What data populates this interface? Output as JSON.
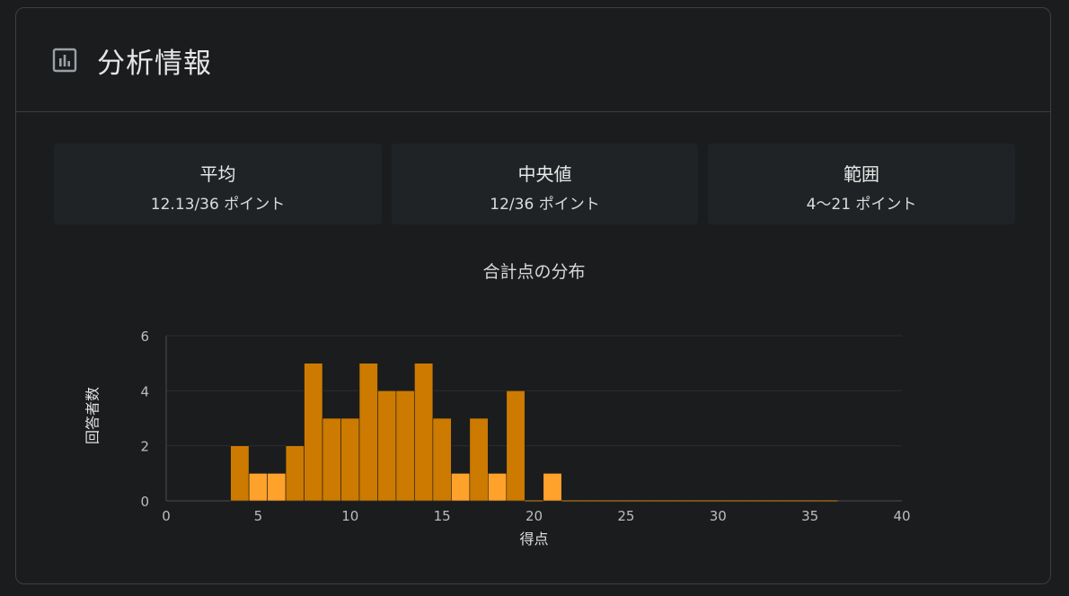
{
  "card": {
    "title": "分析情報",
    "icon": "bar-chart-icon"
  },
  "stats": [
    {
      "label": "平均",
      "value": "12.13/36 ポイント"
    },
    {
      "label": "中央値",
      "value": "12/36 ポイント"
    },
    {
      "label": "範囲",
      "value": "4〜21 ポイント"
    }
  ],
  "colors": {
    "primary_bar": "#cc7a00",
    "highlight_bar": "#ffa22b",
    "background": "#1b1c1e",
    "grid": "#2a2c2f"
  },
  "chart_data": {
    "type": "bar",
    "title": "合計点の分布",
    "xlabel": "得点",
    "ylabel": "回答者数",
    "xlim": [
      0,
      40
    ],
    "ylim": [
      0,
      6
    ],
    "xticks": [
      0,
      5,
      10,
      15,
      20,
      25,
      30,
      35,
      40
    ],
    "yticks": [
      0,
      2,
      4,
      6
    ],
    "bin_width": 1,
    "bins": [
      {
        "x": 4,
        "count": 2,
        "highlight": false
      },
      {
        "x": 5,
        "count": 1,
        "highlight": true
      },
      {
        "x": 6,
        "count": 1,
        "highlight": true
      },
      {
        "x": 7,
        "count": 2,
        "highlight": false
      },
      {
        "x": 8,
        "count": 5,
        "highlight": false
      },
      {
        "x": 9,
        "count": 3,
        "highlight": false
      },
      {
        "x": 10,
        "count": 3,
        "highlight": false
      },
      {
        "x": 11,
        "count": 5,
        "highlight": false
      },
      {
        "x": 12,
        "count": 4,
        "highlight": false
      },
      {
        "x": 13,
        "count": 4,
        "highlight": false
      },
      {
        "x": 14,
        "count": 5,
        "highlight": false
      },
      {
        "x": 15,
        "count": 3,
        "highlight": false
      },
      {
        "x": 16,
        "count": 1,
        "highlight": true
      },
      {
        "x": 17,
        "count": 3,
        "highlight": false
      },
      {
        "x": 18,
        "count": 1,
        "highlight": true
      },
      {
        "x": 19,
        "count": 4,
        "highlight": false
      },
      {
        "x": 20,
        "count": 0,
        "highlight": false
      },
      {
        "x": 21,
        "count": 1,
        "highlight": true
      },
      {
        "x": 22,
        "count": 0,
        "highlight": false
      },
      {
        "x": 23,
        "count": 0,
        "highlight": false
      },
      {
        "x": 24,
        "count": 0,
        "highlight": false
      },
      {
        "x": 25,
        "count": 0,
        "highlight": false
      },
      {
        "x": 26,
        "count": 0,
        "highlight": false
      },
      {
        "x": 27,
        "count": 0,
        "highlight": false
      },
      {
        "x": 28,
        "count": 0,
        "highlight": false
      },
      {
        "x": 29,
        "count": 0,
        "highlight": false
      },
      {
        "x": 30,
        "count": 0,
        "highlight": false
      },
      {
        "x": 31,
        "count": 0,
        "highlight": false
      },
      {
        "x": 32,
        "count": 0,
        "highlight": false
      },
      {
        "x": 33,
        "count": 0,
        "highlight": false
      },
      {
        "x": 34,
        "count": 0,
        "highlight": false
      },
      {
        "x": 35,
        "count": 0,
        "highlight": false
      },
      {
        "x": 36,
        "count": 0,
        "highlight": false
      }
    ],
    "grid": true,
    "legend": "none"
  }
}
